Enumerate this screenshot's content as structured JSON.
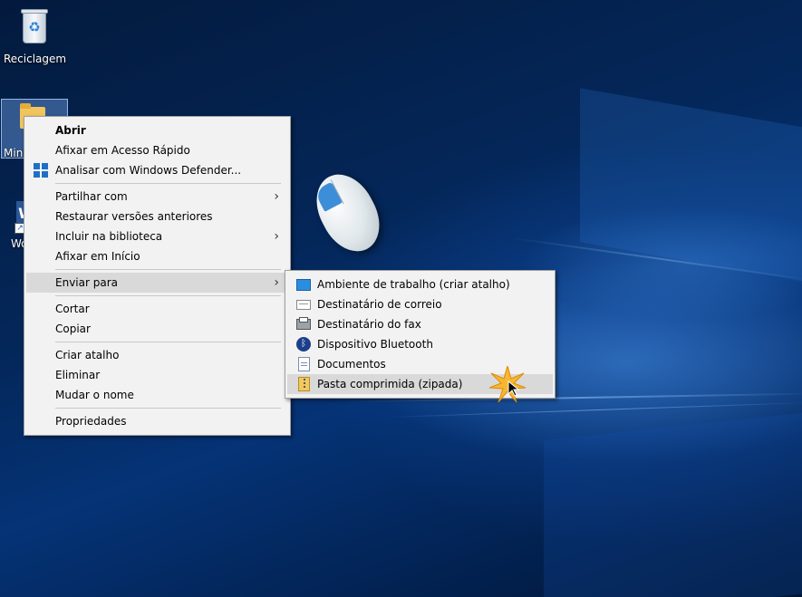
{
  "desktop": {
    "icons": {
      "recycle_bin": "Reciclagem",
      "folder": "Minh",
      "word_shortcut": "Wo"
    }
  },
  "context_menu": {
    "items": [
      {
        "label": "Abrir"
      },
      {
        "label": "Afixar em Acesso Rápido"
      },
      {
        "label": "Analisar com Windows Defender...",
        "icon": "windows-defender-icon"
      },
      {
        "label": "Partilhar com",
        "submenu": true
      },
      {
        "label": "Restaurar versões anteriores"
      },
      {
        "label": "Incluir na biblioteca",
        "submenu": true
      },
      {
        "label": "Afixar em Início"
      },
      {
        "label": "Enviar para",
        "submenu": true,
        "highlighted": true
      },
      {
        "label": "Cortar"
      },
      {
        "label": "Copiar"
      },
      {
        "label": "Criar atalho"
      },
      {
        "label": "Eliminar"
      },
      {
        "label": "Mudar o nome"
      },
      {
        "label": "Propriedades"
      }
    ],
    "submenu_arrow": "›"
  },
  "send_to_menu": {
    "items": [
      {
        "label": "Ambiente de trabalho (criar atalho)",
        "icon": "desktop-icon"
      },
      {
        "label": "Destinatário de correio",
        "icon": "mail-icon"
      },
      {
        "label": "Destinatário do fax",
        "icon": "fax-icon"
      },
      {
        "label": "Dispositivo Bluetooth",
        "icon": "bluetooth-icon"
      },
      {
        "label": "Documentos",
        "icon": "documents-icon"
      },
      {
        "label": "Pasta comprimida (zipada)",
        "icon": "zip-folder-icon",
        "highlighted": true
      }
    ]
  },
  "colors": {
    "menu_background": "#f2f2f2",
    "menu_highlight": "#d9d9d9",
    "wallpaper_dark": "#031a3d",
    "wallpaper_light": "#2a6fc6"
  }
}
